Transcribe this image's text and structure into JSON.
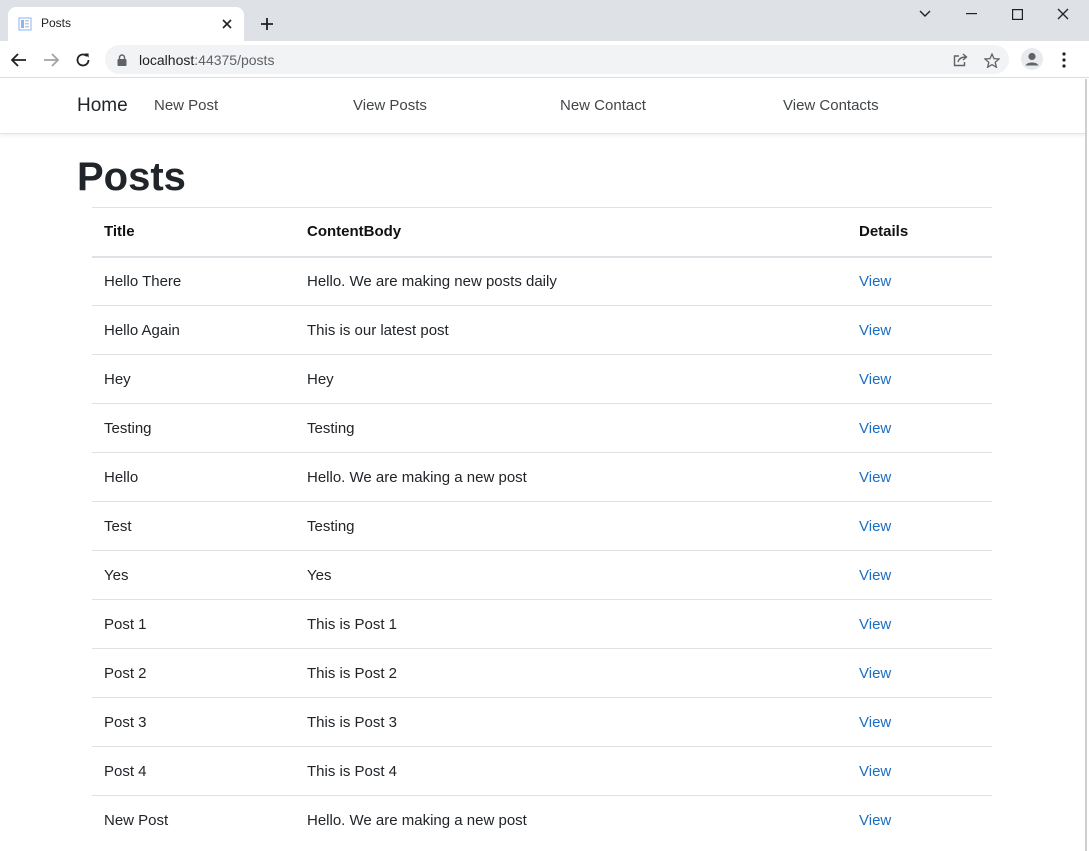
{
  "browser": {
    "tab_title": "Posts",
    "url_host": "localhost",
    "url_rest": ":44375/posts"
  },
  "nav": {
    "brand": "Home",
    "links": [
      "New Post",
      "View Posts",
      "New Contact",
      "View Contacts"
    ]
  },
  "page": {
    "title": "Posts"
  },
  "table": {
    "headers": [
      "Title",
      "ContentBody",
      "Details"
    ],
    "rows": [
      {
        "title": "Hello There",
        "body": "Hello. We are making new posts daily",
        "link": "View"
      },
      {
        "title": "Hello Again",
        "body": "This is our latest post",
        "link": "View"
      },
      {
        "title": "Hey",
        "body": "Hey",
        "link": "View"
      },
      {
        "title": "Testing",
        "body": "Testing",
        "link": "View"
      },
      {
        "title": "Hello",
        "body": "Hello. We are making a new post",
        "link": "View"
      },
      {
        "title": "Test",
        "body": "Testing",
        "link": "View"
      },
      {
        "title": "Yes",
        "body": "Yes",
        "link": "View"
      },
      {
        "title": "Post 1",
        "body": "This is Post 1",
        "link": "View"
      },
      {
        "title": "Post 2",
        "body": "This is Post 2",
        "link": "View"
      },
      {
        "title": "Post 3",
        "body": "This is Post 3",
        "link": "View"
      },
      {
        "title": "Post 4",
        "body": "This is Post 4",
        "link": "View"
      },
      {
        "title": "New Post",
        "body": "Hello. We are making a new post",
        "link": "View"
      }
    ]
  },
  "colors": {
    "link": "#1b6ec2",
    "tabstrip": "#dee1e6",
    "omnibox": "#f1f3f4"
  }
}
